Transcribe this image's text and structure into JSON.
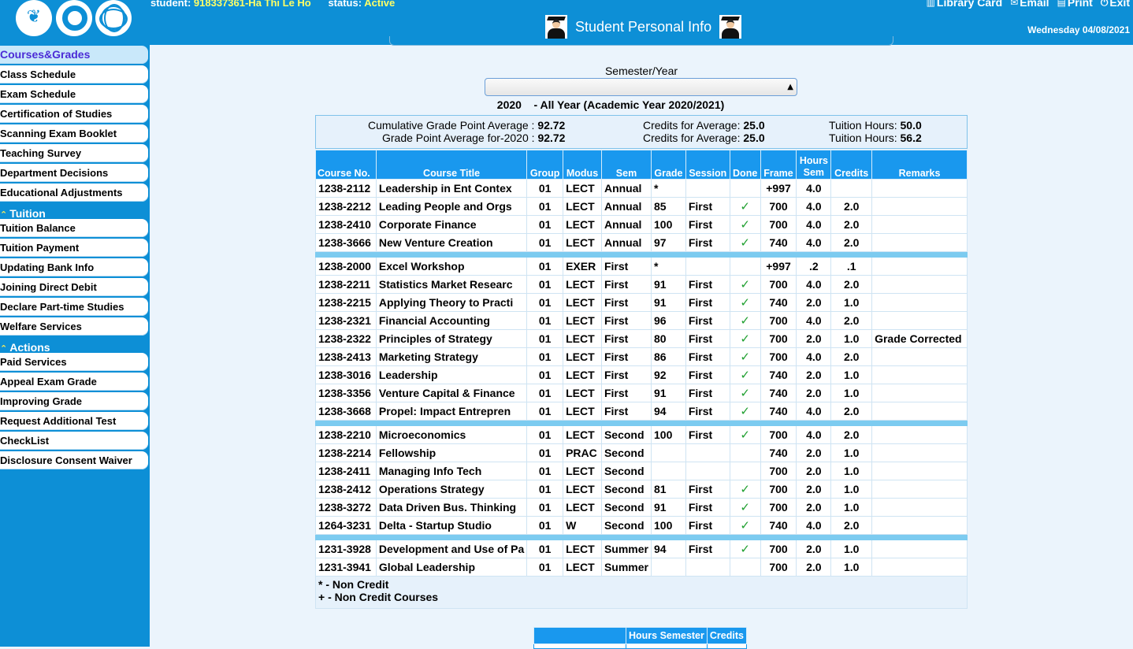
{
  "header": {
    "student_label": "student:",
    "student_value": "918337361-Ha Thi Le Ho",
    "status_label": "status:",
    "status_value": "Active",
    "title": "Student Personal Info",
    "links": [
      "Library Card",
      "Email",
      "Print",
      "Exit"
    ],
    "date": "Wednesday 04/08/2021"
  },
  "sidebar": {
    "group1": [
      "Courses&Grades",
      "Class Schedule",
      "Exam Schedule",
      "Certification of Studies",
      "Scanning Exam Booklet",
      "Teaching Survey",
      "Department Decisions",
      "Educational Adjustments"
    ],
    "tuition_heading": "Tuition",
    "group2": [
      "Tuition Balance",
      "Tuition Payment",
      "Updating Bank Info",
      "Joining Direct Debit",
      "Declare Part-time Studies",
      "Welfare Services"
    ],
    "actions_heading": "Actions",
    "group3": [
      "Paid Services",
      "Appeal Exam Grade",
      "Improving Grade",
      "Request Additional Test",
      "CheckList",
      "Disclosure Consent Waiver"
    ]
  },
  "semester": {
    "label": "Semester/Year",
    "selected": "2020    - All Year (Academic Year 2020/2021)"
  },
  "summary": {
    "cum_gpa_label": "Cumulative Grade Point Average :",
    "cum_gpa_value": "92.72",
    "gpa_year_label": "Grade Point Average for-2020 :",
    "gpa_year_value": "92.72",
    "credits1_label": "Credits for Average:",
    "credits1_value": "25.0",
    "credits2_label": "Credits for Average:",
    "credits2_value": "25.0",
    "tuition1_label": "Tuition Hours:",
    "tuition1_value": "50.0",
    "tuition2_label": "Tuition Hours:",
    "tuition2_value": "56.2"
  },
  "table": {
    "headers": [
      "Course No.",
      "Course Title",
      "Group",
      "Modus",
      "Sem",
      "Grade",
      "Session",
      "Done",
      "Frame",
      "Hours Sem",
      "Credits",
      "Remarks"
    ],
    "groups": [
      [
        [
          "1238-2112",
          "Leadership in Ent Contex",
          "01",
          "LECT",
          "Annual",
          "*",
          "",
          "",
          "+997",
          "4.0",
          "",
          ""
        ],
        [
          "1238-2212",
          "Leading People and Orgs",
          "01",
          "LECT",
          "Annual",
          "85",
          "First",
          "✓",
          "700",
          "4.0",
          "2.0",
          ""
        ],
        [
          "1238-2410",
          "Corporate Finance",
          "01",
          "LECT",
          "Annual",
          "100",
          "First",
          "✓",
          "700",
          "4.0",
          "2.0",
          ""
        ],
        [
          "1238-3666",
          "New Venture Creation",
          "01",
          "LECT",
          "Annual",
          "97",
          "First",
          "✓",
          "740",
          "4.0",
          "2.0",
          ""
        ]
      ],
      [
        [
          "1238-2000",
          "Excel Workshop",
          "01",
          "EXER",
          "First",
          "*",
          "",
          "",
          "+997",
          ".2",
          ".1",
          ""
        ],
        [
          "1238-2211",
          "Statistics Market Researc",
          "01",
          "LECT",
          "First",
          "91",
          "First",
          "✓",
          "700",
          "4.0",
          "2.0",
          ""
        ],
        [
          "1238-2215",
          "Applying Theory to Practi",
          "01",
          "LECT",
          "First",
          "91",
          "First",
          "✓",
          "740",
          "2.0",
          "1.0",
          ""
        ],
        [
          "1238-2321",
          "Financial Accounting",
          "01",
          "LECT",
          "First",
          "96",
          "First",
          "✓",
          "700",
          "4.0",
          "2.0",
          ""
        ],
        [
          "1238-2322",
          "Principles of Strategy",
          "01",
          "LECT",
          "First",
          "80",
          "First",
          "✓",
          "700",
          "2.0",
          "1.0",
          "Grade Corrected"
        ],
        [
          "1238-2413",
          "Marketing Strategy",
          "01",
          "LECT",
          "First",
          "86",
          "First",
          "✓",
          "700",
          "4.0",
          "2.0",
          ""
        ],
        [
          "1238-3016",
          "Leadership",
          "01",
          "LECT",
          "First",
          "92",
          "First",
          "✓",
          "740",
          "2.0",
          "1.0",
          ""
        ],
        [
          "1238-3356",
          "Venture Capital & Finance",
          "01",
          "LECT",
          "First",
          "91",
          "First",
          "✓",
          "740",
          "2.0",
          "1.0",
          ""
        ],
        [
          "1238-3668",
          "Propel: Impact Entrepren",
          "01",
          "LECT",
          "First",
          "94",
          "First",
          "✓",
          "740",
          "4.0",
          "2.0",
          ""
        ]
      ],
      [
        [
          "1238-2210",
          "Microeconomics",
          "01",
          "LECT",
          "Second",
          "100",
          "First",
          "✓",
          "700",
          "4.0",
          "2.0",
          ""
        ],
        [
          "1238-2214",
          "Fellowship",
          "01",
          "PRAC",
          "Second",
          "",
          "",
          "",
          "740",
          "2.0",
          "1.0",
          ""
        ],
        [
          "1238-2411",
          "Managing Info Tech",
          "01",
          "LECT",
          "Second",
          "",
          "",
          "",
          "700",
          "2.0",
          "1.0",
          ""
        ],
        [
          "1238-2412",
          "Operations Strategy",
          "01",
          "LECT",
          "Second",
          "81",
          "First",
          "✓",
          "700",
          "2.0",
          "1.0",
          ""
        ],
        [
          "1238-3272",
          "Data Driven Bus. Thinking",
          "01",
          "LECT",
          "Second",
          "91",
          "First",
          "✓",
          "700",
          "2.0",
          "1.0",
          ""
        ],
        [
          "1264-3231",
          "Delta - Startup Studio",
          "01",
          "W",
          "Second",
          "100",
          "First",
          "✓",
          "740",
          "4.0",
          "2.0",
          ""
        ]
      ],
      [
        [
          "1231-3928",
          "Development and Use of Pa",
          "01",
          "LECT",
          "Summer",
          "94",
          "First",
          "✓",
          "700",
          "2.0",
          "1.0",
          ""
        ],
        [
          "1231-3941",
          "Global Leadership",
          "01",
          "LECT",
          "Summer",
          "",
          "",
          "",
          "700",
          "2.0",
          "1.0",
          ""
        ]
      ]
    ],
    "footnote_1": "* - Non Credit",
    "footnote_2": "+ - Non Credit Courses"
  },
  "mini_table": {
    "headers": [
      "",
      "Hours Semester",
      "Credits"
    ]
  },
  "colors": {
    "brand_blue": "#0d8fd6",
    "header_blue": "#1998ee",
    "separator": "#7ccbf0",
    "status_yellow": "#ffff66",
    "done_green": "#20a030"
  }
}
